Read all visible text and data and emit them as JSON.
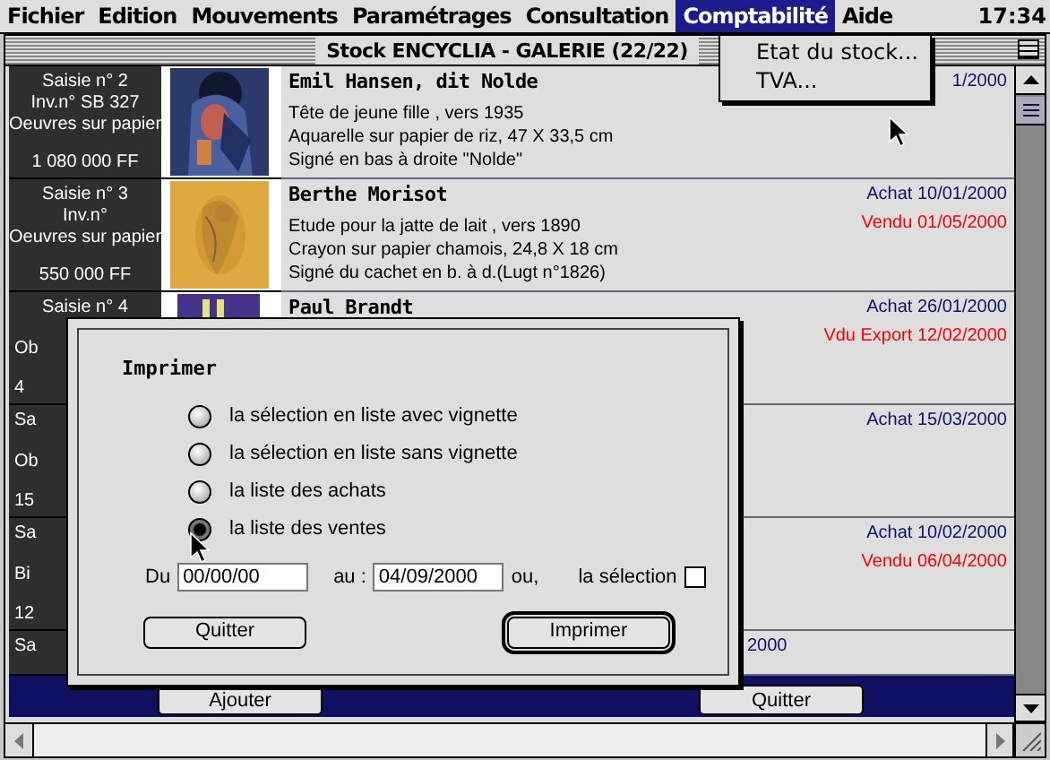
{
  "menubar": {
    "items": [
      {
        "label": "Fichier",
        "selected": false
      },
      {
        "label": "Edition",
        "selected": false
      },
      {
        "label": "Mouvements",
        "selected": false
      },
      {
        "label": "Paramétrages",
        "selected": false
      },
      {
        "label": "Consultation",
        "selected": false
      },
      {
        "label": "Comptabilité",
        "selected": true
      },
      {
        "label": "Aide",
        "selected": false
      }
    ],
    "clock": "17:34"
  },
  "menu": {
    "items": [
      "Etat du stock...",
      "TVA..."
    ]
  },
  "window": {
    "title": "Stock ENCYCLIA - GALERIE (22/22)"
  },
  "rows": [
    {
      "kind": "full",
      "left": [
        "Saisie n° 2",
        "Inv.n°  SB 327",
        "Oeuvres sur papier"
      ],
      "price": "1 080 000 FF",
      "image": {
        "kind": "picture"
      },
      "artist": "Emil Hansen, dit Nolde",
      "lines": [
        "Tête de jeune fille , vers 1935",
        "Aquarelle sur papier de riz, 47 X 33,5 cm",
        "Signé en bas à droite \"Nolde\""
      ],
      "dates": [
        {
          "text": "1/2000",
          "kind": "achat"
        }
      ]
    },
    {
      "kind": "full",
      "left": [
        "Saisie n° 3",
        "Inv.n°",
        "Oeuvres sur papier"
      ],
      "price": "550 000 FF",
      "image": {
        "kind": "picture"
      },
      "artist": "Berthe Morisot",
      "lines": [
        "Etude pour la jatte de lait , vers 1890",
        "Crayon sur papier chamois, 24,8 X 18 cm",
        "Signé du cachet en b. à d.(Lugt n°1826)"
      ],
      "dates": [
        {
          "text": "Achat 10/01/2000",
          "kind": "achat"
        },
        {
          "text": "Vendu 01/05/2000",
          "kind": "vente"
        }
      ]
    },
    {
      "kind": "partial",
      "left": [
        {
          "text": "Saisie n° 4",
          "kind": "whole"
        },
        {
          "text": "Ob",
          "kind": "cut"
        },
        {
          "text": "4",
          "kind": "cut"
        }
      ],
      "image": {
        "kind": "picture"
      },
      "artist": "Paul Brandt",
      "dates": [
        {
          "text": "Achat 26/01/2000",
          "kind": "achat"
        },
        {
          "text": "Vdu Export 12/02/2000",
          "kind": "vente"
        }
      ]
    },
    {
      "kind": "partial",
      "left": [
        {
          "text": "Sa",
          "kind": "cut"
        },
        {
          "text": "Ob",
          "kind": "cut"
        },
        {
          "text": "15",
          "kind": "cut"
        }
      ],
      "dates": [
        {
          "text": "Achat 15/03/2000",
          "kind": "achat"
        }
      ]
    },
    {
      "kind": "partial",
      "left": [
        {
          "text": "Sa",
          "kind": "cut"
        },
        {
          "text": "Bi",
          "kind": "cut"
        },
        {
          "text": "12",
          "kind": "cut"
        }
      ],
      "dates": [
        {
          "text": "Achat 10/02/2000",
          "kind": "achat"
        },
        {
          "text": "Vendu 06/04/2000",
          "kind": "vente"
        }
      ]
    },
    {
      "kind": "last",
      "left": [
        {
          "text": "Sa",
          "kind": "cut"
        }
      ],
      "fragment": "2000"
    }
  ],
  "bottom_buttons": [
    "Ajouter",
    "Quitter"
  ],
  "dialog": {
    "title": "Imprimer",
    "options": [
      {
        "label": "la sélection en liste avec vignette",
        "selected": false
      },
      {
        "label": "la sélection en liste sans vignette",
        "selected": false
      },
      {
        "label": "la liste des achats",
        "selected": false
      },
      {
        "label": "la liste des ventes",
        "selected": true
      }
    ],
    "from_label": "Du",
    "from": "00/00/00",
    "to_label": "au :",
    "to": "04/09/2000",
    "or_label": "ou,",
    "selection_label": "la sélection",
    "selection_checked": false,
    "buttons": [
      {
        "label": "Quitter",
        "default": false
      },
      {
        "label": "Imprimer",
        "default": true
      }
    ]
  }
}
